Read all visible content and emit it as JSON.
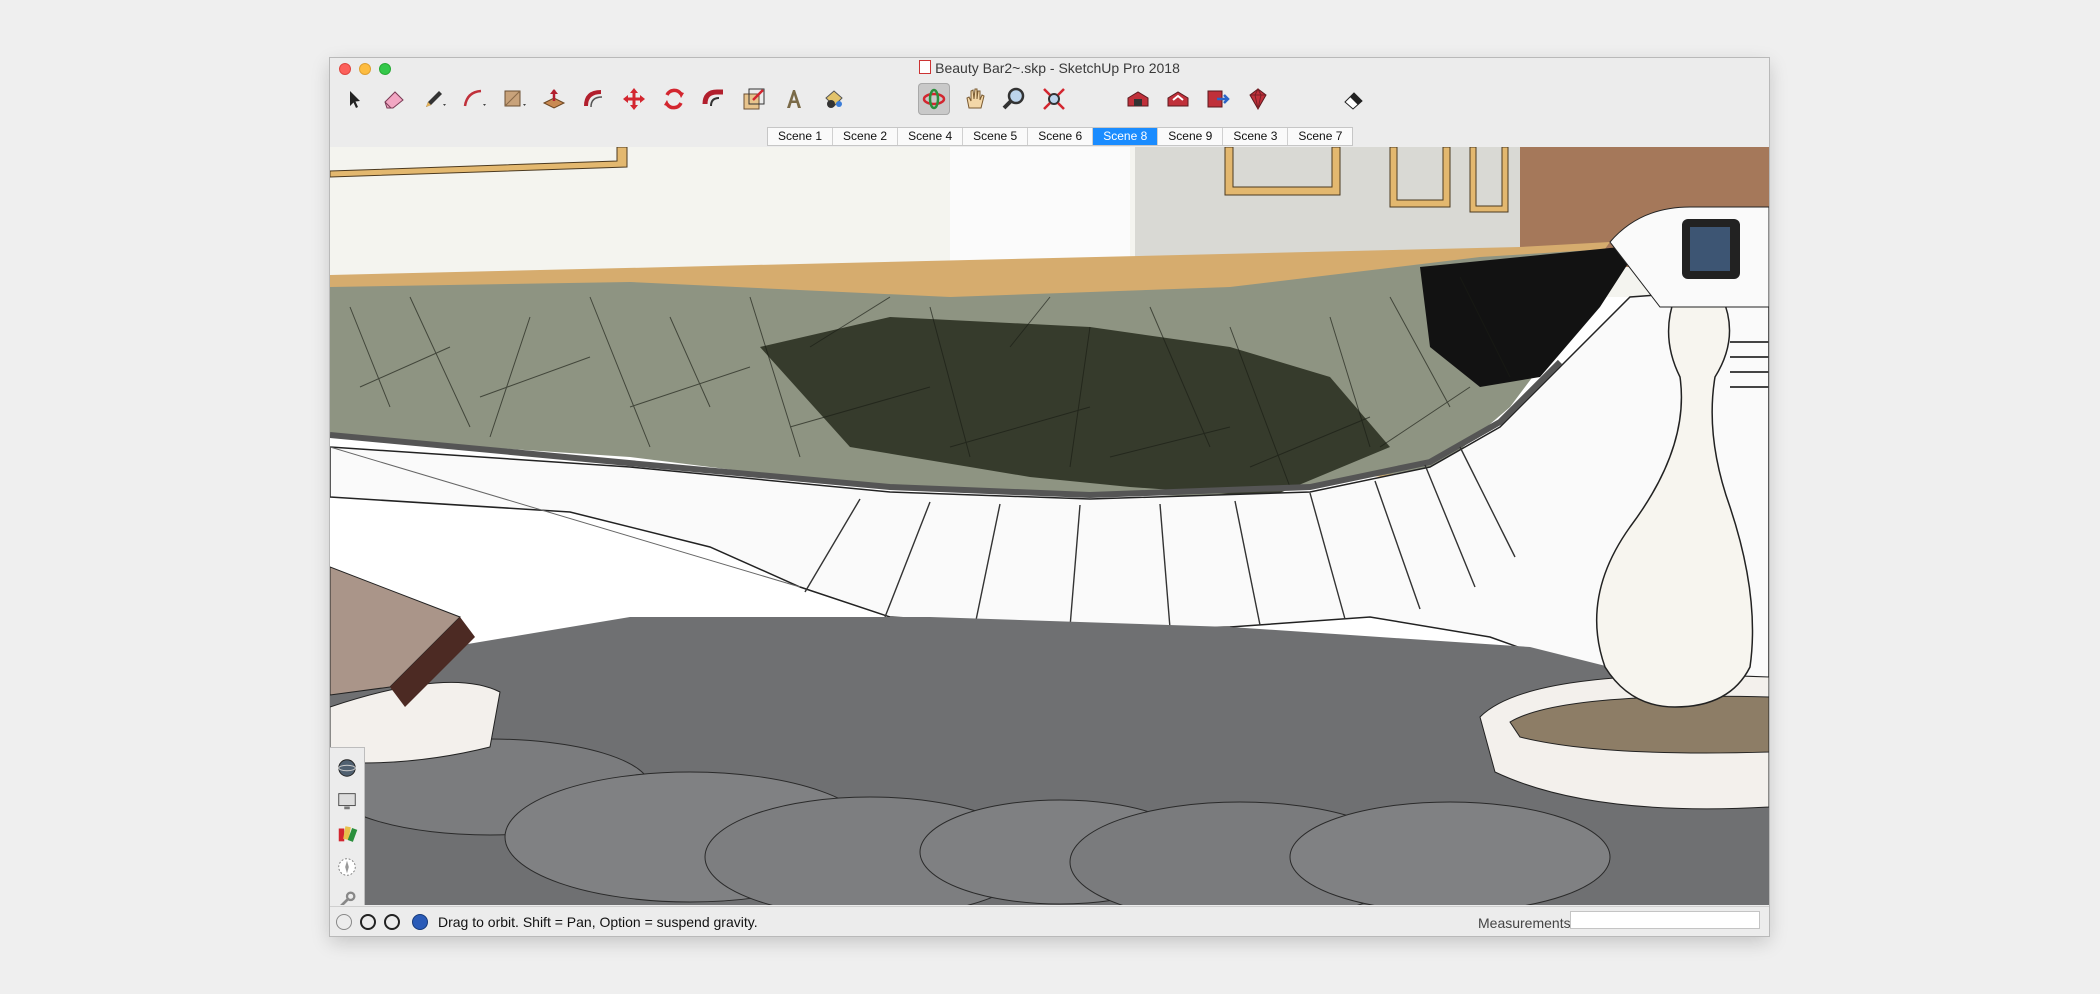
{
  "window": {
    "title": "Beauty Bar2~.skp - SketchUp Pro 2018"
  },
  "toolbar": {
    "tools": [
      {
        "name": "select-tool-icon"
      },
      {
        "name": "eraser-tool-icon"
      },
      {
        "name": "pencil-tool-icon"
      },
      {
        "name": "arc-tool-icon"
      },
      {
        "name": "shape-tool-icon"
      },
      {
        "name": "push-pull-tool-icon"
      },
      {
        "name": "offset-tool-icon"
      },
      {
        "name": "move-tool-icon"
      },
      {
        "name": "rotate-tool-icon"
      },
      {
        "name": "follow-me-tool-icon"
      },
      {
        "name": "scale-tool-icon"
      },
      {
        "name": "text-tool-icon"
      },
      {
        "name": "paint-bucket-tool-icon"
      },
      {
        "name": "orbit-tool-icon"
      },
      {
        "name": "pan-tool-icon"
      },
      {
        "name": "zoom-tool-icon"
      },
      {
        "name": "zoom-extents-tool-icon"
      },
      {
        "name": "warehouse-icon"
      },
      {
        "name": "share-model-icon"
      },
      {
        "name": "share-component-icon"
      },
      {
        "name": "extension-warehouse-icon"
      },
      {
        "name": "layout-eraser-icon"
      }
    ]
  },
  "scenes": {
    "tabs": [
      "Scene 1",
      "Scene 2",
      "Scene 4",
      "Scene 5",
      "Scene 6",
      "Scene 8",
      "Scene 9",
      "Scene 3",
      "Scene 7"
    ],
    "selected": "Scene 8"
  },
  "palette": {
    "items": [
      "sphere-style-icon",
      "monitor-icon",
      "paint-chips-icon",
      "compass-icon",
      "wrench-icon",
      "components-box-icon",
      "lightbulb-icon"
    ]
  },
  "status": {
    "hint": "Drag to orbit. Shift = Pan, Option = suspend gravity.",
    "measurements_label": "Measurements",
    "measurements_value": ""
  },
  "colors": {
    "selected_tab": "#1a8cff",
    "close": "#fc605b",
    "minimize": "#fdbc40",
    "zoom": "#34c84a"
  }
}
